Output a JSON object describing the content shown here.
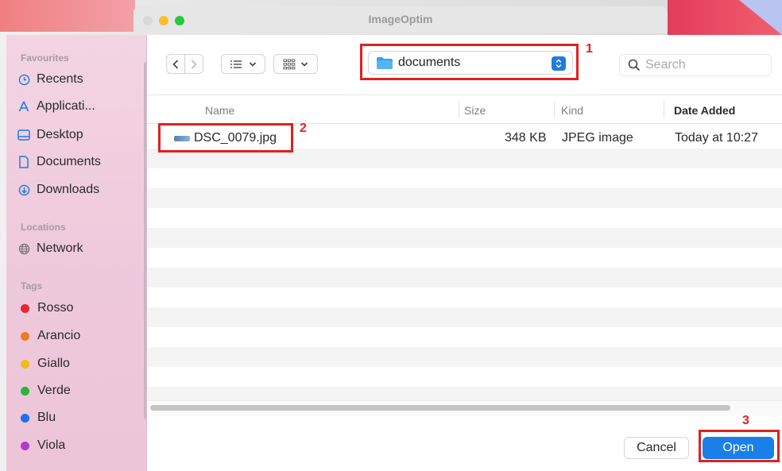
{
  "window": {
    "title": "ImageOptim"
  },
  "sidebar": {
    "favourites_label": "Favourites",
    "favourites": [
      {
        "label": "Recents",
        "icon": "clock-icon"
      },
      {
        "label": "Applicati...",
        "icon": "applications-icon"
      },
      {
        "label": "Desktop",
        "icon": "desktop-icon"
      },
      {
        "label": "Documents",
        "icon": "document-icon"
      },
      {
        "label": "Downloads",
        "icon": "download-icon"
      }
    ],
    "locations_label": "Locations",
    "locations": [
      {
        "label": "Network",
        "icon": "globe-icon"
      }
    ],
    "tags_label": "Tags",
    "tags": [
      {
        "label": "Rosso",
        "color": "#e8262c"
      },
      {
        "label": "Arancio",
        "color": "#f07a24"
      },
      {
        "label": "Giallo",
        "color": "#f5b91a"
      },
      {
        "label": "Verde",
        "color": "#27b534"
      },
      {
        "label": "Blu",
        "color": "#1f6ff0"
      },
      {
        "label": "Viola",
        "color": "#b03ccc"
      }
    ]
  },
  "toolbar": {
    "location": "documents",
    "search_placeholder": "Search"
  },
  "columns": {
    "name": "Name",
    "size": "Size",
    "kind": "Kind",
    "date": "Date Added"
  },
  "files": [
    {
      "name": "DSC_0079.jpg",
      "size": "348 KB",
      "kind": "JPEG image",
      "date": "Today at 10:27"
    }
  ],
  "footer": {
    "cancel_label": "Cancel",
    "open_label": "Open"
  },
  "annotations": [
    "1",
    "2",
    "3"
  ],
  "colors": {
    "accent": "#1a7fe8",
    "annotation": "#e02020"
  }
}
